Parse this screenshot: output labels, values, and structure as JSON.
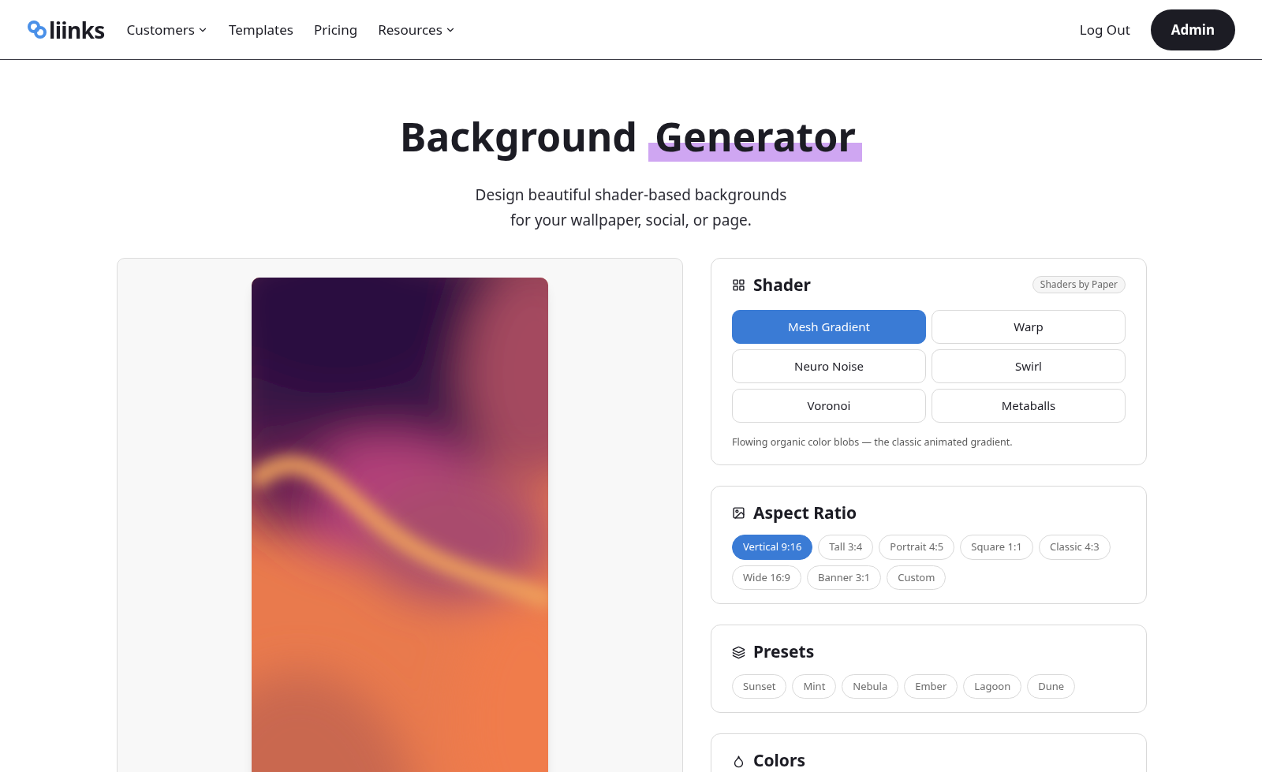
{
  "nav": {
    "logo": "liinks",
    "items": [
      {
        "label": "Customers",
        "dropdown": true
      },
      {
        "label": "Templates",
        "dropdown": false
      },
      {
        "label": "Pricing",
        "dropdown": false
      },
      {
        "label": "Resources",
        "dropdown": true
      }
    ],
    "logout": "Log Out",
    "admin": "Admin"
  },
  "hero": {
    "title": "Background",
    "title_highlight": "Generator",
    "subtitle_lines": [
      "Design beautiful shader-based backgrounds",
      "for your wallpaper, social, or page."
    ]
  },
  "shader": {
    "title": "Shader",
    "badge": "Shaders by Paper",
    "options": [
      {
        "label": "Mesh Gradient",
        "selected": true
      },
      {
        "label": "Warp",
        "selected": false
      },
      {
        "label": "Neuro Noise",
        "selected": false
      },
      {
        "label": "Swirl",
        "selected": false
      },
      {
        "label": "Voronoi",
        "selected": false
      },
      {
        "label": "Metaballs",
        "selected": false
      }
    ],
    "description": "Flowing organic color blobs — the classic animated gradient."
  },
  "aspect_ratio": {
    "title": "Aspect Ratio",
    "options": [
      {
        "label": "Vertical 9:16",
        "selected": true
      },
      {
        "label": "Tall 3:4",
        "selected": false
      },
      {
        "label": "Portrait 4:5",
        "selected": false
      },
      {
        "label": "Square 1:1",
        "selected": false
      },
      {
        "label": "Classic 4:3",
        "selected": false
      },
      {
        "label": "Wide 16:9",
        "selected": false
      },
      {
        "label": "Banner 3:1",
        "selected": false
      },
      {
        "label": "Custom",
        "selected": false
      }
    ]
  },
  "presets": {
    "title": "Presets",
    "options": [
      {
        "label": "Sunset",
        "selected": false
      },
      {
        "label": "Mint",
        "selected": false
      },
      {
        "label": "Nebula",
        "selected": false
      },
      {
        "label": "Ember",
        "selected": false
      },
      {
        "label": "Lagoon",
        "selected": false
      },
      {
        "label": "Dune",
        "selected": false
      }
    ]
  },
  "colors": {
    "title": "Colors"
  }
}
